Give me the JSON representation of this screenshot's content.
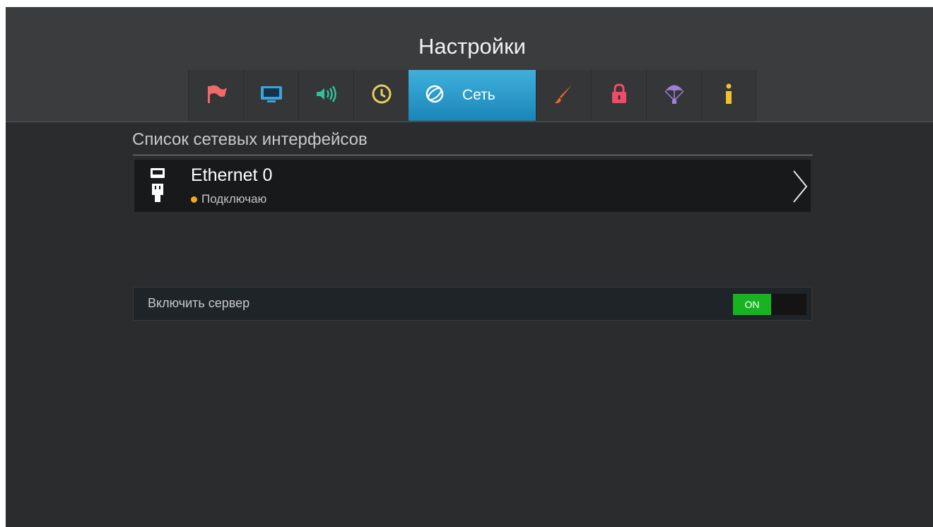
{
  "header": {
    "title": "Настройки"
  },
  "tabs": [
    {
      "icon": "flag-icon",
      "color": "#f06a6a"
    },
    {
      "icon": "tv-icon",
      "color": "#3fa3db"
    },
    {
      "icon": "speaker-icon",
      "color": "#33c19a"
    },
    {
      "icon": "clock-icon",
      "color": "#e3d05a"
    },
    {
      "icon": "network-icon",
      "label": "Сеть",
      "active": true
    },
    {
      "icon": "brush-icon",
      "color": "#ef6a2d"
    },
    {
      "icon": "lock-icon",
      "color": "#f04a6a"
    },
    {
      "icon": "parachute-icon",
      "color": "#a180d8"
    },
    {
      "icon": "info-icon",
      "color": "#f3c22a"
    }
  ],
  "interfaces": {
    "section_title": "Список сетевых интерфейсов",
    "items": [
      {
        "name": "Ethernet 0",
        "status": "Подключаю",
        "status_color": "#f5a623"
      }
    ]
  },
  "server": {
    "label": "Включить сервер",
    "toggle_label": "ON",
    "toggle_color": "#17b320"
  }
}
